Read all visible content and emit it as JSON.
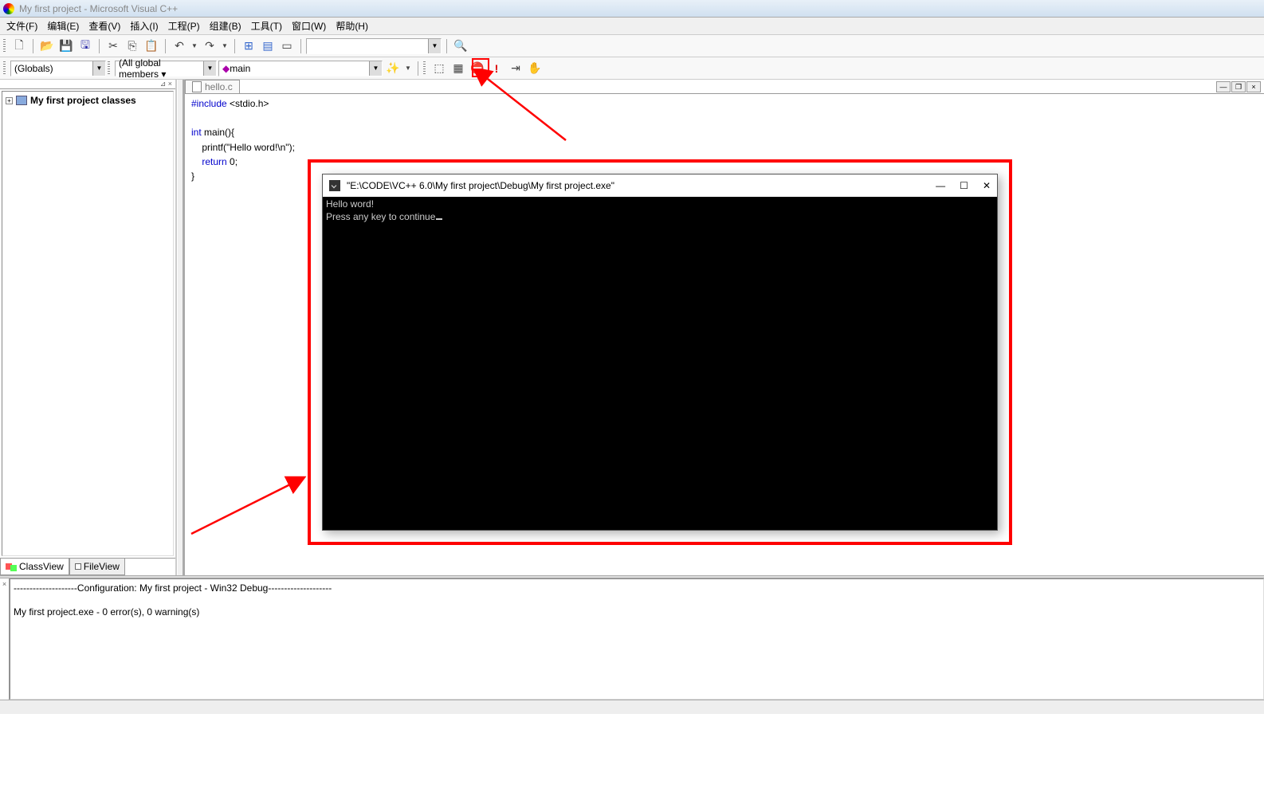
{
  "title": "My first project - Microsoft Visual C++",
  "menus": {
    "file": "文件(F)",
    "edit": "编辑(E)",
    "view": "查看(V)",
    "insert": "插入(I)",
    "project": "工程(P)",
    "build": "组建(B)",
    "tools": "工具(T)",
    "window": "窗口(W)",
    "help": "帮助(H)"
  },
  "toolbar2": {
    "scope": "(Globals)",
    "members": "(All global members ▾",
    "func_icon": "◆",
    "func": "main"
  },
  "sidebar": {
    "root": "My first project classes",
    "tabs": {
      "classview": "ClassView",
      "fileview": "FileView"
    }
  },
  "editor": {
    "filename": "hello.c",
    "code": {
      "l1_a": "#include",
      "l1_b": " <stdio.h>",
      "l2": "",
      "l3_a": "int",
      "l3_b": " main(){",
      "l4_a": "    printf(",
      "l4_b": "\"Hello word!\\n\"",
      "l4_c": ");",
      "l5_a": "    ",
      "l5_b": "return",
      "l5_c": " 0;",
      "l6": "}"
    }
  },
  "console": {
    "title": "\"E:\\CODE\\VC++ 6.0\\My first project\\Debug\\My first project.exe\"",
    "line1": "Hello word!",
    "line2": "Press any key to continue"
  },
  "output": {
    "line1": "--------------------Configuration: My first project - Win32 Debug--------------------",
    "line2": "",
    "line3": "My first project.exe - 0 error(s), 0 warning(s)"
  }
}
